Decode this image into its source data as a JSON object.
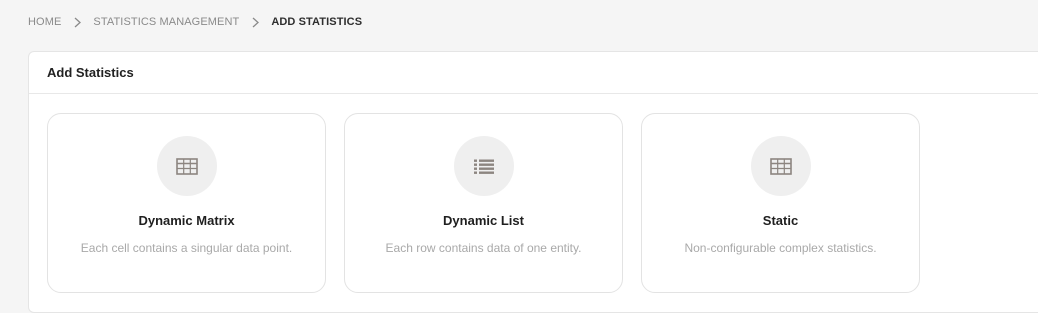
{
  "breadcrumb": {
    "items": [
      "HOME",
      "STATISTICS MANAGEMENT",
      "ADD STATISTICS"
    ]
  },
  "panel": {
    "title": "Add Statistics"
  },
  "cards": [
    {
      "icon": "table-icon",
      "title": "Dynamic Matrix",
      "description": "Each cell contains a singular data point."
    },
    {
      "icon": "list-icon",
      "title": "Dynamic List",
      "description": "Each row contains data of one entity."
    },
    {
      "icon": "table-icon",
      "title": "Static",
      "description": "Non-configurable complex statistics."
    }
  ],
  "colors": {
    "background": "#f5f5f5",
    "icon": "#8c8580",
    "icon_circle": "#efefef",
    "muted_text": "#a9a9a9"
  }
}
